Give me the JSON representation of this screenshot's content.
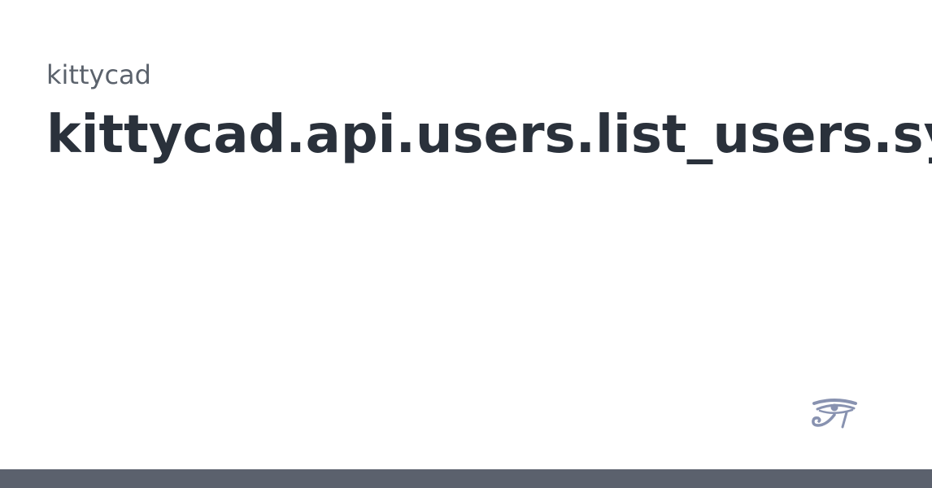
{
  "card": {
    "owner": "kittycad",
    "title": "kittycad.api.users.list_users.sync"
  },
  "logo": {
    "icon": "eye-of-horus-icon",
    "color": "#8892b0"
  },
  "footer": {
    "color": "#5b616d"
  }
}
